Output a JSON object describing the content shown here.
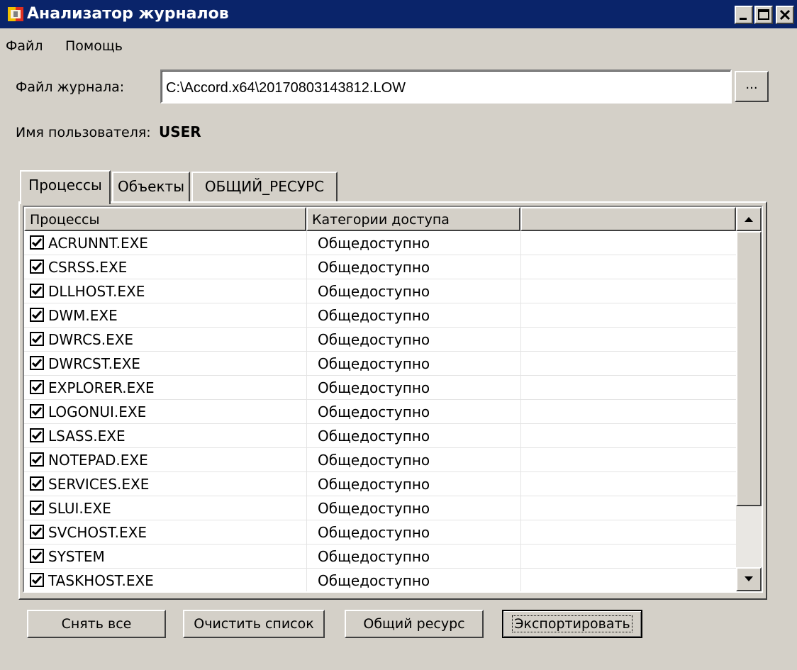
{
  "window": {
    "title": "Анализатор журналов"
  },
  "menu": [
    {
      "label": "Файл"
    },
    {
      "label": "Помощь"
    }
  ],
  "log_file": {
    "label": "Файл журнала:",
    "value": "C:\\Accord.x64\\20170803143812.LOW",
    "browse_label": "..."
  },
  "user": {
    "label": "Имя пользователя:",
    "name": "USER"
  },
  "tabs": [
    {
      "label": "Процессы",
      "active": true
    },
    {
      "label": "Объекты",
      "active": false
    },
    {
      "label": "ОБЩИЙ_РЕСУРС",
      "active": false
    }
  ],
  "table": {
    "columns": [
      "Процессы",
      "Категории доступа",
      ""
    ],
    "rows": [
      {
        "name": "ACRUNNT.EXE",
        "category": "Общедоступно",
        "checked": true
      },
      {
        "name": "CSRSS.EXE",
        "category": "Общедоступно",
        "checked": true
      },
      {
        "name": "DLLHOST.EXE",
        "category": "Общедоступно",
        "checked": true
      },
      {
        "name": "DWM.EXE",
        "category": "Общедоступно",
        "checked": true
      },
      {
        "name": "DWRCS.EXE",
        "category": "Общедоступно",
        "checked": true
      },
      {
        "name": "DWRCST.EXE",
        "category": "Общедоступно",
        "checked": true
      },
      {
        "name": "EXPLORER.EXE",
        "category": "Общедоступно",
        "checked": true
      },
      {
        "name": "LOGONUI.EXE",
        "category": "Общедоступно",
        "checked": true
      },
      {
        "name": "LSASS.EXE",
        "category": "Общедоступно",
        "checked": true
      },
      {
        "name": "NOTEPAD.EXE",
        "category": "Общедоступно",
        "checked": true
      },
      {
        "name": "SERVICES.EXE",
        "category": "Общедоступно",
        "checked": true
      },
      {
        "name": "SLUI.EXE",
        "category": "Общедоступно",
        "checked": true
      },
      {
        "name": "SVCHOST.EXE",
        "category": "Общедоступно",
        "checked": true
      },
      {
        "name": "SYSTEM",
        "category": "Общедоступно",
        "checked": true
      },
      {
        "name": "TASKHOST.EXE",
        "category": "Общедоступно",
        "checked": true
      }
    ]
  },
  "buttons": {
    "uncheck_all": "Снять все",
    "clear_list": "Очистить список",
    "shared_resource": "Общий ресурс",
    "export": "Экспортировать"
  },
  "colors": {
    "titlebar": "#0a246a",
    "face": "#d4d0c8"
  },
  "icons": [
    "app-icon",
    "minimize-icon",
    "maximize-icon",
    "close-icon",
    "checkbox-checked-icon",
    "scroll-up-arrow-icon",
    "scroll-down-arrow-icon"
  ]
}
